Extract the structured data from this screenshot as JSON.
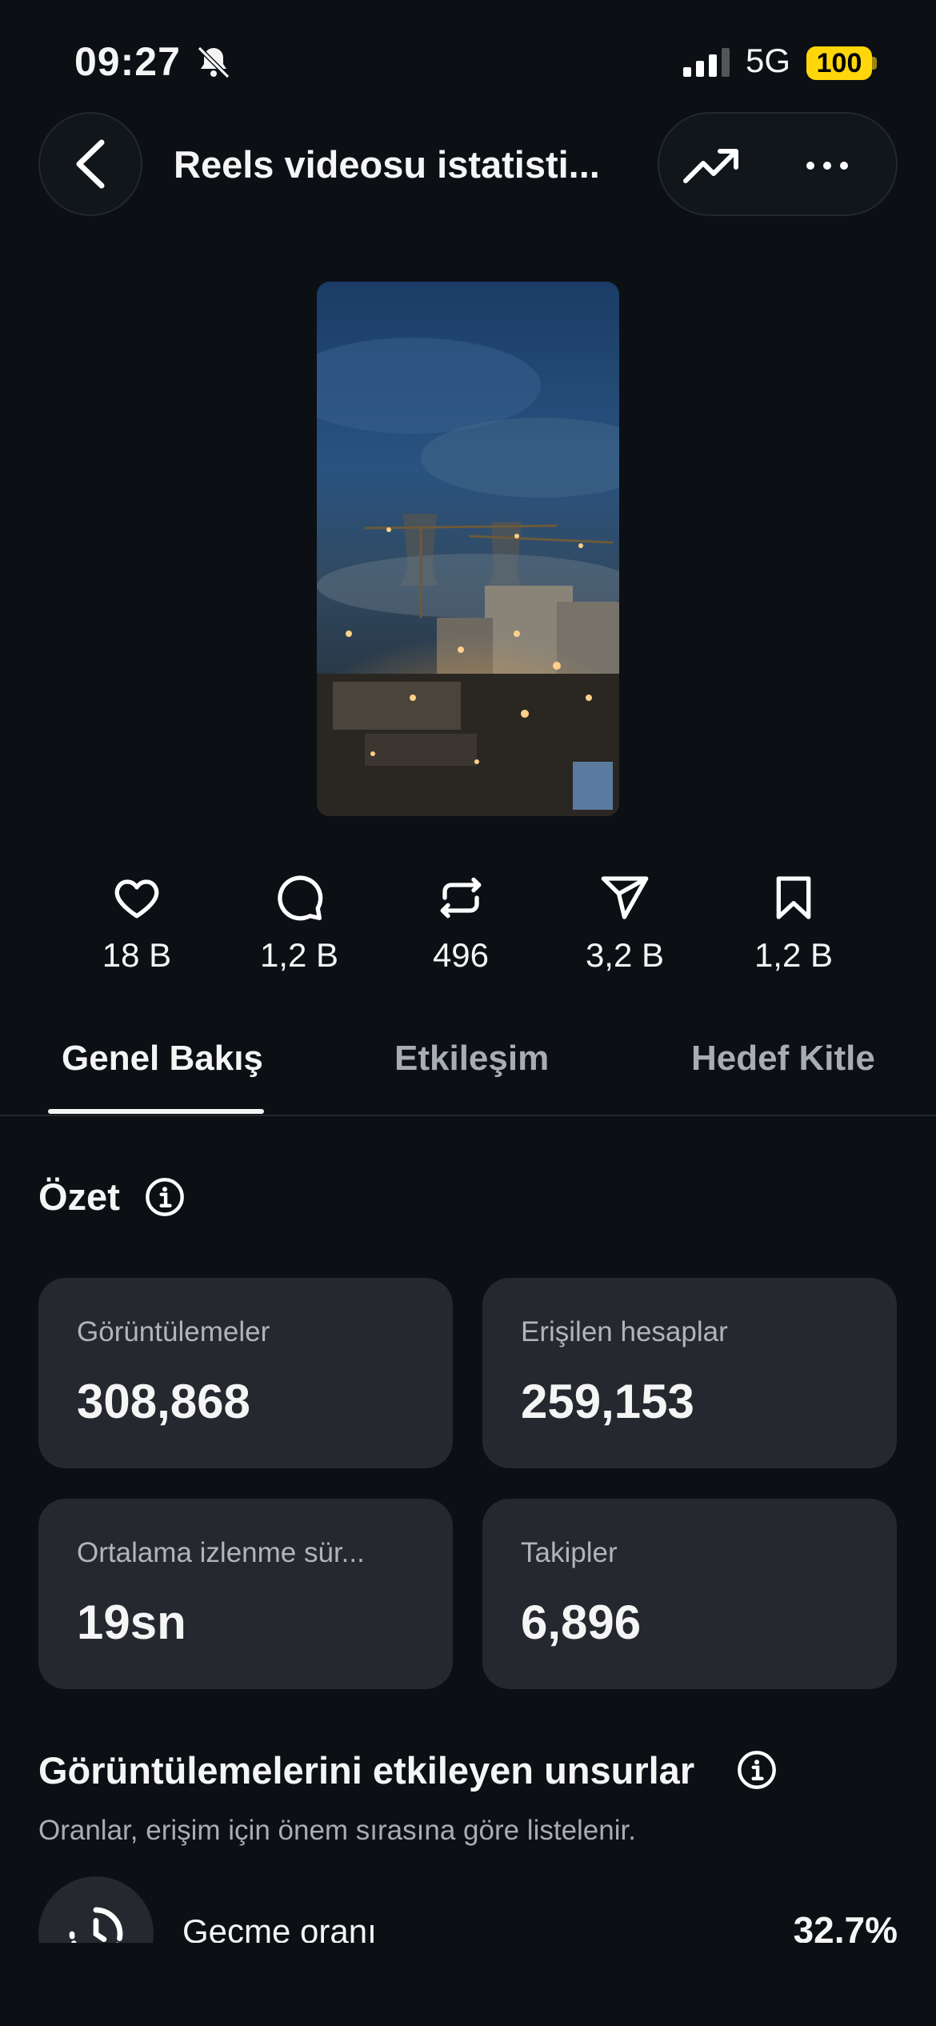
{
  "status": {
    "time": "09:27",
    "network": "5G",
    "battery": "100"
  },
  "header": {
    "title": "Reels videosu istatisti..."
  },
  "metrics": [
    {
      "icon": "heart-icon",
      "value": "18 B"
    },
    {
      "icon": "comment-icon",
      "value": "1,2 B"
    },
    {
      "icon": "repost-icon",
      "value": "496"
    },
    {
      "icon": "share-icon",
      "value": "3,2 B"
    },
    {
      "icon": "bookmark-icon",
      "value": "1,2 B"
    }
  ],
  "tabs": [
    {
      "label": "Genel Bakış",
      "active": true
    },
    {
      "label": "Etkileşim",
      "active": false
    },
    {
      "label": "Hedef Kitle",
      "active": false
    }
  ],
  "summary": {
    "title": "Özet",
    "cards": [
      {
        "label": "Görüntülemeler",
        "value": "308,868"
      },
      {
        "label": "Erişilen hesaplar",
        "value": "259,153"
      },
      {
        "label": "Ortalama izlenme sür...",
        "value": "19sn"
      },
      {
        "label": "Takipler",
        "value": "6,896"
      }
    ]
  },
  "factors": {
    "title": "Görüntülemelerini etkileyen unsurlar",
    "subtitle": "Oranlar, erişim için önem sırasına göre listelenir.",
    "rows": [
      {
        "label": "Geçme oranı",
        "value": "32,7%"
      }
    ]
  },
  "colors": {
    "background": "#0c1014",
    "card": "#25282e",
    "battery": "#ffd60a"
  }
}
